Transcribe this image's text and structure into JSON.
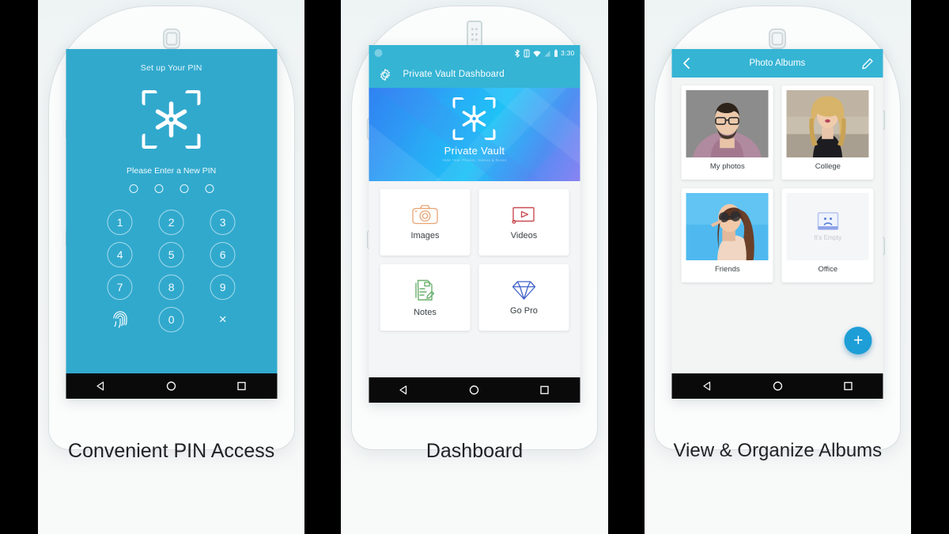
{
  "panels": [
    {
      "caption": "Convenient PIN Access",
      "screen": {
        "title": "Set up Your PIN",
        "subtitle": "Please Enter a New PIN",
        "pin_dots": 4,
        "keys": [
          "1",
          "2",
          "3",
          "4",
          "5",
          "6",
          "7",
          "8",
          "9",
          "fingerprint",
          "0",
          "×"
        ],
        "accent": "#31A9CD"
      },
      "navbar": {
        "back": "back-triangle",
        "home": "home-circle",
        "recents": "recents-square"
      }
    },
    {
      "caption": "Dashboard",
      "statusbar": {
        "time": "3:30",
        "icons": [
          "bluetooth-icon",
          "rotation-icon",
          "wifi-icon",
          "signal-icon",
          "battery-icon"
        ]
      },
      "appbar": {
        "title": "Private Vault Dashboard",
        "settings_icon": "gear-icon"
      },
      "hero": {
        "brand": "Private Vault",
        "tagline": "Hide Your Photos, Videos & Notes"
      },
      "tiles": [
        {
          "label": "Images",
          "icon": "camera-icon",
          "color": "#E8A372"
        },
        {
          "label": "Videos",
          "icon": "video-icon",
          "color": "#C94C53"
        },
        {
          "label": "Notes",
          "icon": "notepad-icon",
          "color": "#6CB06E"
        },
        {
          "label": "Go Pro",
          "icon": "diamond-icon",
          "color": "#4062C8"
        }
      ],
      "navbar": {
        "back": "back-triangle",
        "home": "home-circle",
        "recents": "recents-square"
      }
    },
    {
      "caption": "View & Organize Albums",
      "appbar": {
        "title": "Photo Albums",
        "back_icon": "chevron-left-icon",
        "edit_icon": "pencil-icon"
      },
      "albums": [
        {
          "name": "My photos",
          "thumb": "man-with-glasses-photo",
          "empty": false
        },
        {
          "name": "College",
          "thumb": "blonde-woman-photo",
          "empty": false
        },
        {
          "name": "Friends",
          "thumb": "woman-sunglasses-photo",
          "empty": false
        },
        {
          "name": "Office",
          "thumb": "empty-placeholder",
          "empty": true,
          "empty_label": "It's Empty"
        }
      ],
      "fab": {
        "label": "+",
        "icon": "plus-icon",
        "color": "#1E9ED6"
      },
      "navbar": {
        "back": "back-triangle",
        "home": "home-circle",
        "recents": "recents-square"
      }
    }
  ]
}
